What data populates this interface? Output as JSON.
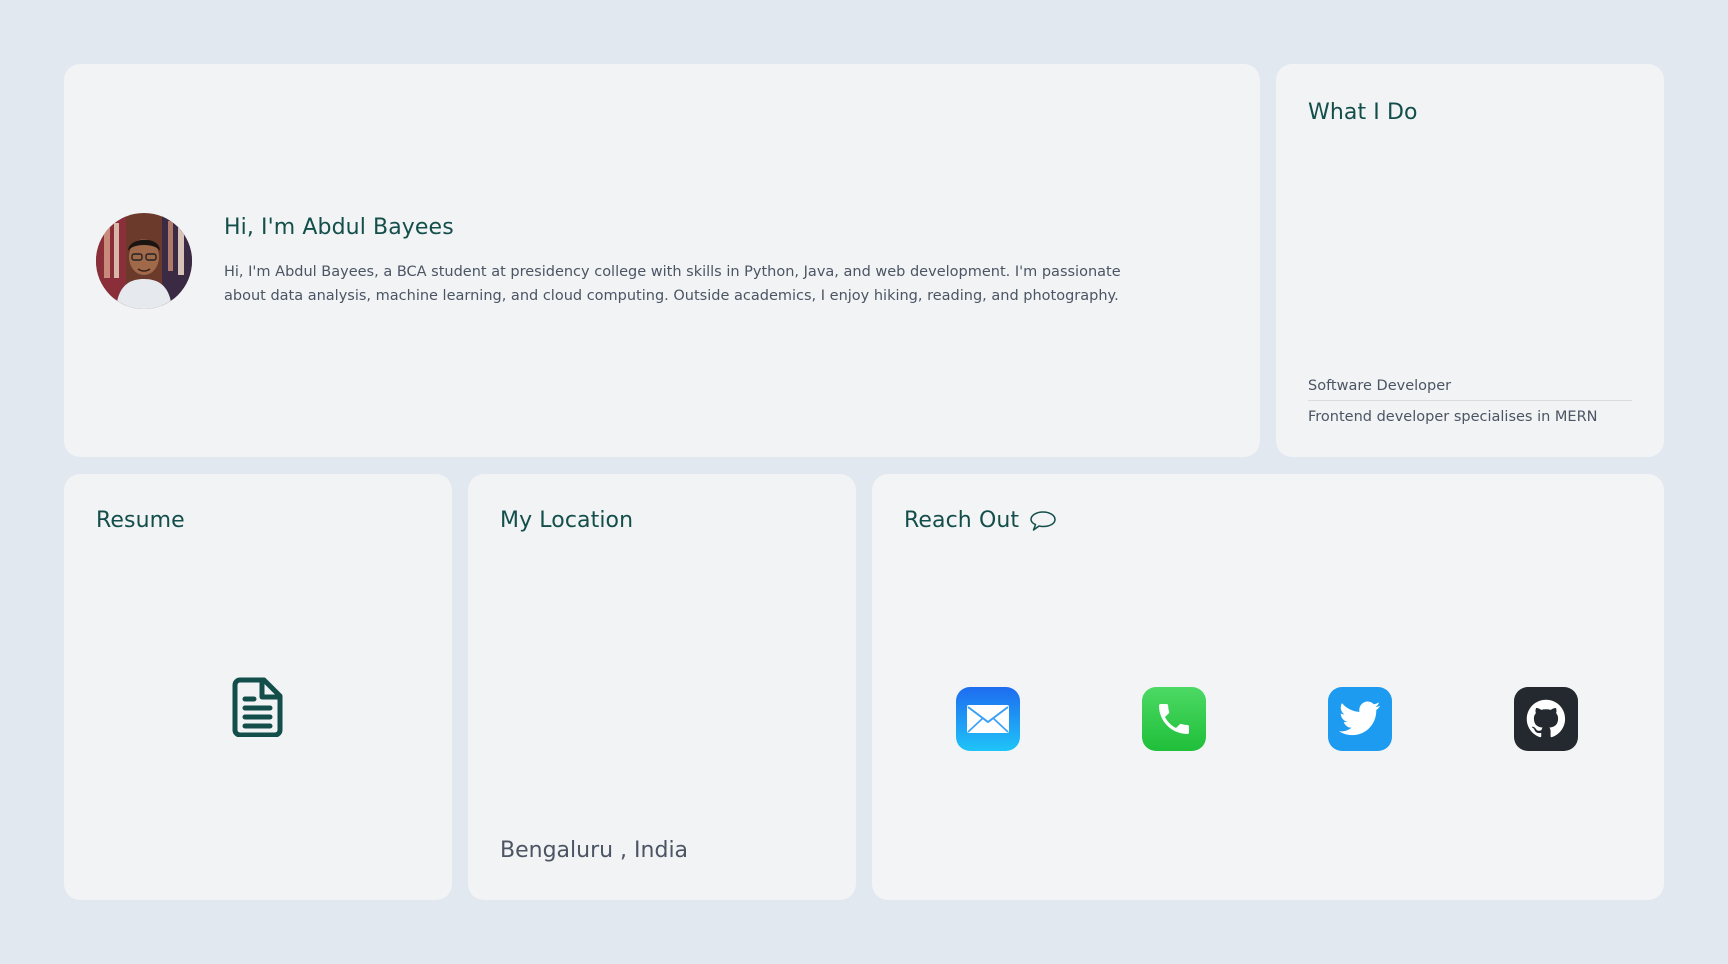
{
  "intro": {
    "title": "Hi, I'm Abdul Bayees",
    "text": "Hi, I'm Abdul Bayees, a BCA student at presidency college with skills in Python, Java, and web development. I'm passionate about data analysis, machine learning, and cloud computing. Outside academics, I enjoy hiking, reading, and photography."
  },
  "what_i_do": {
    "title": "What I Do",
    "roles": [
      "Software Developer",
      "Frontend developer specialises in MERN"
    ]
  },
  "resume": {
    "title": "Resume",
    "icon": "document-icon"
  },
  "location": {
    "title": "My Location",
    "text": "Bengaluru , India"
  },
  "reach_out": {
    "title": "Reach Out",
    "icon": "speech-bubble-icon",
    "links": [
      {
        "name": "mail",
        "icon": "mail-icon",
        "color": "#1e6cf0"
      },
      {
        "name": "phone",
        "icon": "phone-icon",
        "color": "#34c759"
      },
      {
        "name": "twitter",
        "icon": "twitter-icon",
        "color": "#1d9bf0"
      },
      {
        "name": "github",
        "icon": "github-icon",
        "color": "#24292f"
      }
    ]
  },
  "colors": {
    "background": "#e2e8f0",
    "card": "#f1f3f5",
    "heading": "#134e4a",
    "body_text": "#4b5563"
  }
}
